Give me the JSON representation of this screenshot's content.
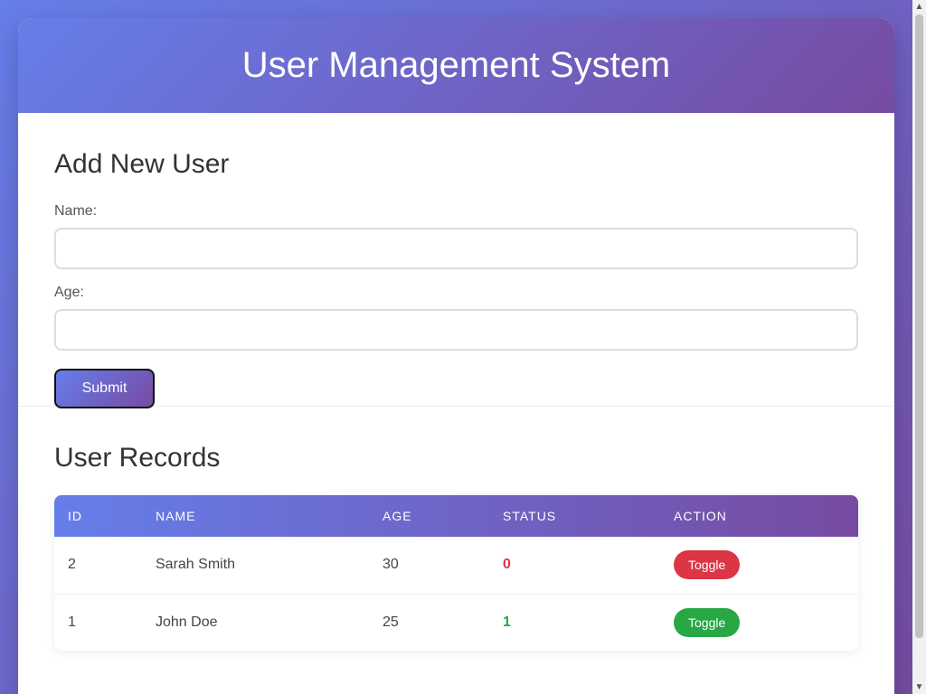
{
  "header": {
    "title": "User Management System"
  },
  "form": {
    "title": "Add New User",
    "name_label": "Name:",
    "name_value": "",
    "age_label": "Age:",
    "age_value": "",
    "submit_label": "Submit"
  },
  "records": {
    "title": "User Records",
    "columns": [
      "ID",
      "NAME",
      "AGE",
      "STATUS",
      "ACTION"
    ],
    "rows": [
      {
        "id": "2",
        "name": "Sarah Smith",
        "age": "30",
        "status": "0",
        "action": "Toggle",
        "action_color": "#dc3545"
      },
      {
        "id": "1",
        "name": "John Doe",
        "age": "25",
        "status": "1",
        "action": "Toggle",
        "action_color": "#28a745"
      }
    ]
  },
  "icons": {
    "scroll_up": "chevron-up-icon",
    "scroll_down": "chevron-down-icon"
  },
  "colors": {
    "accent_start": "#667eea",
    "accent_end": "#764ba2",
    "status_off": "#dc3545",
    "status_on": "#28a745"
  }
}
